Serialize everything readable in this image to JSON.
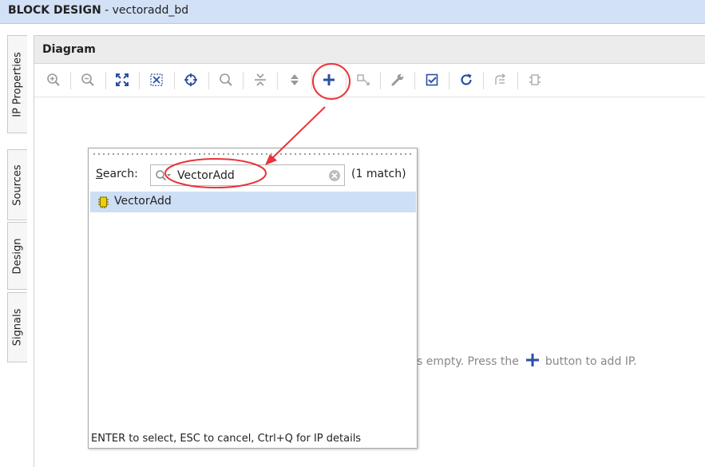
{
  "title_bar": {
    "app": "BLOCK DESIGN",
    "separator": " - ",
    "design": "vectoradd_bd"
  },
  "side_tabs": [
    "IP Properties",
    "Sources",
    "Design",
    "Signals"
  ],
  "panel": {
    "title": "Diagram"
  },
  "toolbar": {
    "icons": [
      "zoom-in-icon",
      "zoom-out-icon",
      "zoom-fit-icon",
      "zoom-area-icon",
      "center-icon",
      "search-icon",
      "collapse-icon",
      "expand-icon",
      "add-ip-icon",
      "make-connection-icon",
      "properties-icon",
      "validate-icon",
      "refresh-icon",
      "regenerate-layout-icon",
      "pin-icon"
    ]
  },
  "canvas": {
    "empty_msg_before": "s empty. Press the",
    "empty_msg_after": "button to add IP."
  },
  "ip_search": {
    "label_underlined": "S",
    "label_rest": "earch:",
    "query": "VectorAdd",
    "match_count": "(1 match)",
    "results": [
      {
        "name": "VectorAdd"
      }
    ],
    "hint": "ENTER to select, ESC to cancel, Ctrl+Q for IP details"
  },
  "colors": {
    "accent": "#2b4fa0",
    "annotation": "#e8343a",
    "selection": "#cddff5",
    "title_bar": "#d3e1f7"
  }
}
